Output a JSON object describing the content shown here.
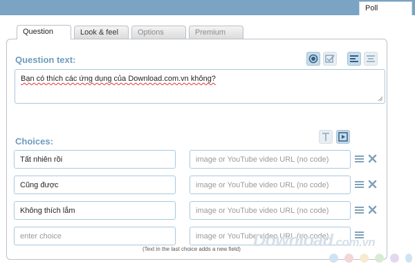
{
  "window": {
    "top_tab": "Poll"
  },
  "tabs": [
    {
      "label": "Question",
      "active": true
    },
    {
      "label": "Look & feel",
      "active": false
    },
    {
      "label": "Options",
      "active": false
    },
    {
      "label": "Premium",
      "active": false
    }
  ],
  "question": {
    "label": "Question text:",
    "value": "Bạn có thích các ứng dụng của Download.com.vn không?"
  },
  "question_toolbar": {
    "single_choice_icon": "radio-icon",
    "multiple_choice_icon": "checkbox-icon",
    "layout_list_icon": "align-left-icon",
    "layout_center_icon": "align-center-icon"
  },
  "choices": {
    "label": "Choices:",
    "text_mode_icon": "text-icon",
    "media_mode_icon": "media-icon",
    "items": [
      {
        "text": "Tất nhiên rồi",
        "url_placeholder": "image or YouTube video URL (no code)"
      },
      {
        "text": "Cũng được",
        "url_placeholder": "image or YouTube video URL (no code)"
      },
      {
        "text": "Không thích lắm",
        "url_placeholder": "image or YouTube video URL (no code)"
      }
    ],
    "new_choice_placeholder": "enter choice",
    "new_url_placeholder": "image or YouTube video URL (no code)",
    "hint": "(Text in the last choice adds a new field)"
  },
  "watermark": {
    "main": "Download",
    "suffix": ".com.vn"
  },
  "colors": {
    "accent": "#6d9bbd",
    "topbar": "#7aa3c4",
    "input_border": "#a8c8de"
  }
}
